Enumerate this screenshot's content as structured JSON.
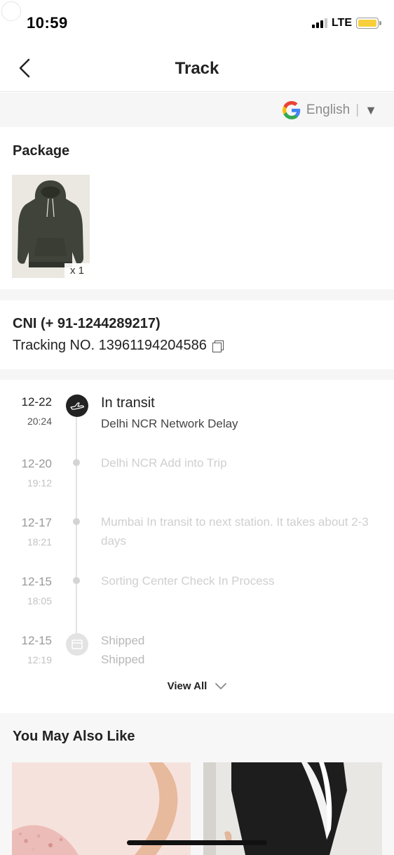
{
  "status_bar": {
    "time": "10:59",
    "network": "LTE",
    "battery_color": "#f7cf3a"
  },
  "header": {
    "title": "Track",
    "back_icon": "chevron-left-icon"
  },
  "translate": {
    "language": "English",
    "separator": "|",
    "caret": "▼",
    "icon": "google-g-icon"
  },
  "package": {
    "title": "Package",
    "items": [
      {
        "image": "olive-hoodie-product",
        "quantity": "x 1"
      }
    ]
  },
  "carrier": {
    "name": "CNI (+ 91-1244289217)",
    "tracking": "Tracking NO. 13961194204586",
    "copy_icon": "copy-icon"
  },
  "timeline": {
    "events": [
      {
        "date": "12-22",
        "time": "20:24",
        "status": "In transit",
        "detail": "Delhi NCR Network Delay",
        "icon": "airplane-icon",
        "current": true
      },
      {
        "date": "12-20",
        "time": "19:12",
        "detail": "Delhi NCR Add into Trip"
      },
      {
        "date": "12-17",
        "time": "18:21",
        "detail": "Mumbai In transit to next station. It takes about 2-3 days"
      },
      {
        "date": "12-15",
        "time": "18:05",
        "detail": "Sorting Center Check In Process"
      },
      {
        "date": "12-15",
        "time": "12:19",
        "status": "Shipped",
        "detail": "Shipped",
        "icon": "box-icon"
      }
    ],
    "view_all_label": "View All"
  },
  "recommendations": {
    "title": "You May Also Like",
    "items": [
      {
        "image": "pink-sequin-product"
      },
      {
        "image": "black-leggings-product"
      }
    ]
  }
}
